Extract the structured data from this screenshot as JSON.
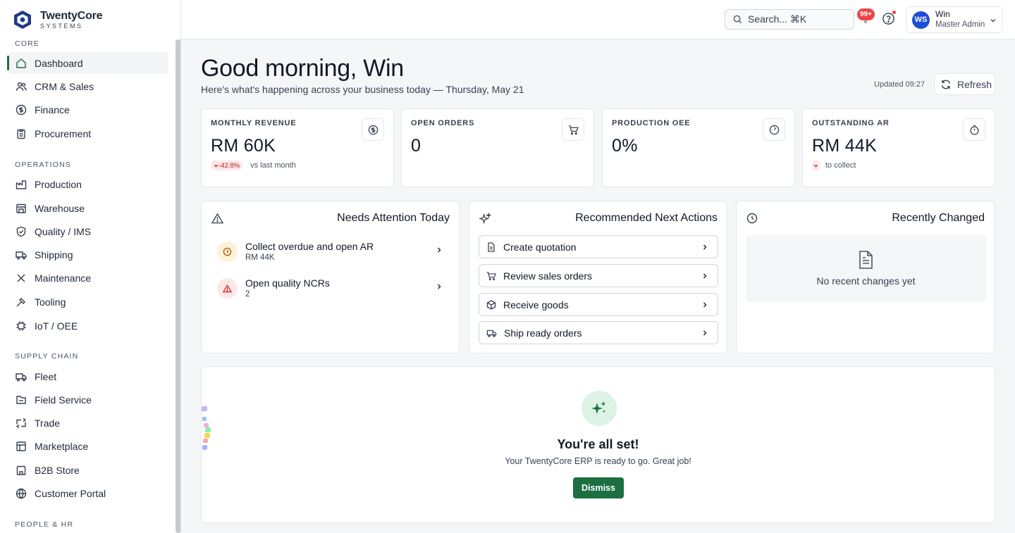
{
  "app": {
    "brand": "TwentyCore",
    "brand_sub": "SYSTEMS"
  },
  "sidebar": {
    "sections": [
      {
        "label": "CORE",
        "items": [
          {
            "label": "Dashboard",
            "icon": "home-icon",
            "active": true
          },
          {
            "label": "CRM & Sales",
            "icon": "users-icon"
          },
          {
            "label": "Finance",
            "icon": "dollar-icon"
          },
          {
            "label": "Procurement",
            "icon": "clipboard-icon"
          }
        ]
      },
      {
        "label": "OPERATIONS",
        "items": [
          {
            "label": "Production",
            "icon": "factory-icon"
          },
          {
            "label": "Warehouse",
            "icon": "warehouse-icon"
          },
          {
            "label": "Quality / IMS",
            "icon": "shield-check-icon"
          },
          {
            "label": "Shipping",
            "icon": "truck-icon"
          },
          {
            "label": "Maintenance",
            "icon": "wrench-icon"
          },
          {
            "label": "Tooling",
            "icon": "hammer-icon"
          },
          {
            "label": "IoT / OEE",
            "icon": "chip-icon"
          }
        ]
      },
      {
        "label": "SUPPLY CHAIN",
        "items": [
          {
            "label": "Fleet",
            "icon": "truck-icon"
          },
          {
            "label": "Field Service",
            "icon": "map-pin-icon"
          },
          {
            "label": "Trade",
            "icon": "briefcase-icon"
          },
          {
            "label": "Marketplace",
            "icon": "storefront-icon"
          },
          {
            "label": "B2B Store",
            "icon": "store-icon"
          },
          {
            "label": "Customer Portal",
            "icon": "globe-icon"
          }
        ]
      },
      {
        "label": "PEOPLE & HR",
        "items": []
      }
    ]
  },
  "topbar": {
    "search_placeholder": "Search... ⌘K",
    "notifications_badge": "99+",
    "user": {
      "initials": "WS",
      "name": "Win",
      "role": "Master Admin"
    }
  },
  "header": {
    "greeting": "Good morning, Win",
    "subtitle": "Here's what's happening across your business today — Thursday, May 21",
    "updated": "Updated 09:27",
    "refresh_label": "Refresh"
  },
  "kpis": [
    {
      "label": "MONTHLY REVENUE",
      "value": "RM 60K",
      "delta": "-42.8%",
      "note": "vs last month",
      "icon": "dollar-circle-icon"
    },
    {
      "label": "OPEN ORDERS",
      "value": "0",
      "icon": "cart-icon"
    },
    {
      "label": "PRODUCTION OEE",
      "value": "0%",
      "icon": "gauge-icon"
    },
    {
      "label": "OUTSTANDING AR",
      "value": "RM 44K",
      "delta": "",
      "note": "to collect",
      "icon": "timer-icon"
    }
  ],
  "attention": {
    "title": "Needs Attention Today",
    "items": [
      {
        "title": "Collect overdue and open AR",
        "sub": "RM 44K",
        "icon": "clock-icon",
        "tint": "#fdf2d8",
        "color": "#b45309"
      },
      {
        "title": "Open quality NCRs",
        "sub": "2",
        "icon": "alert-triangle-icon",
        "tint": "#fde8e8",
        "color": "#dc2626"
      }
    ]
  },
  "recommended": {
    "title": "Recommended Next Actions",
    "items": [
      {
        "label": "Create quotation",
        "icon": "file-icon"
      },
      {
        "label": "Review sales orders",
        "icon": "cart-icon"
      },
      {
        "label": "Receive goods",
        "icon": "package-icon"
      },
      {
        "label": "Ship ready orders",
        "icon": "truck-icon"
      }
    ]
  },
  "recent": {
    "title": "Recently Changed",
    "empty": "No recent changes yet"
  },
  "celebration": {
    "title": "You're all set!",
    "sub": "Your TwentyCore ERP is ready to go. Great job!",
    "dismiss": "Dismiss"
  },
  "colors": {
    "accent": "#1d6f42",
    "badge": "#ef4444",
    "avatar": "#1d4ed8"
  }
}
